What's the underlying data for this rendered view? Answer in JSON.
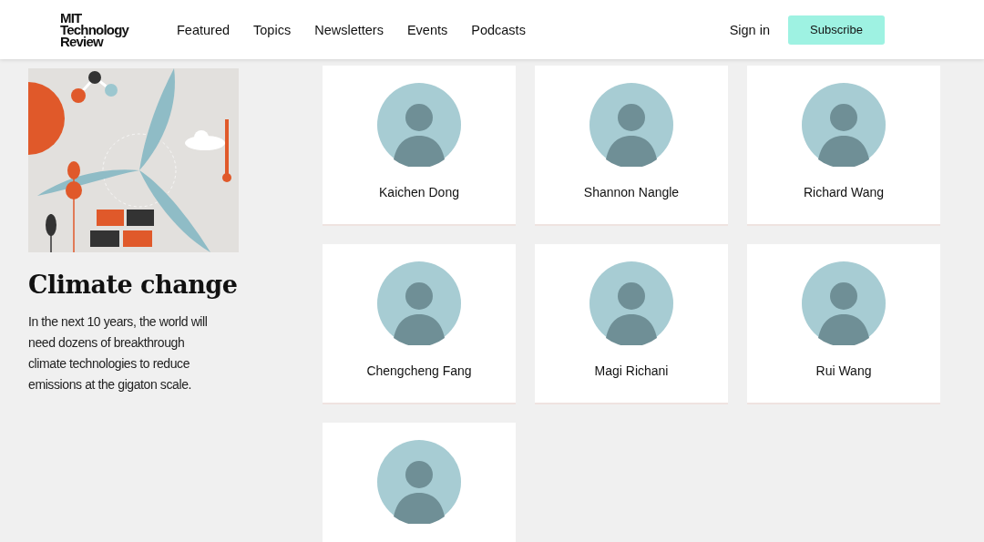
{
  "header": {
    "logo_lines": [
      "MIT",
      "Technology",
      "Review"
    ],
    "nav": [
      "Featured",
      "Topics",
      "Newsletters",
      "Events",
      "Podcasts"
    ],
    "sign_in": "Sign in",
    "subscribe": "Subscribe"
  },
  "topic": {
    "title": "Climate change",
    "description": "In the next 10 years, the world will need dozens of breakthrough climate technologies to reduce emissions at the gigaton scale."
  },
  "people": [
    {
      "kind": "named",
      "name": "Kaichen Dong"
    },
    {
      "kind": "named",
      "name": "Shannon Nangle"
    },
    {
      "kind": "named",
      "name": "Richard Wang"
    },
    {
      "kind": "named",
      "name": "Chengcheng Fang"
    },
    {
      "kind": "named",
      "name": "Magi Richani"
    },
    {
      "kind": "named",
      "name": "Rui Wang"
    },
    {
      "kind": "cut_off"
    }
  ]
}
